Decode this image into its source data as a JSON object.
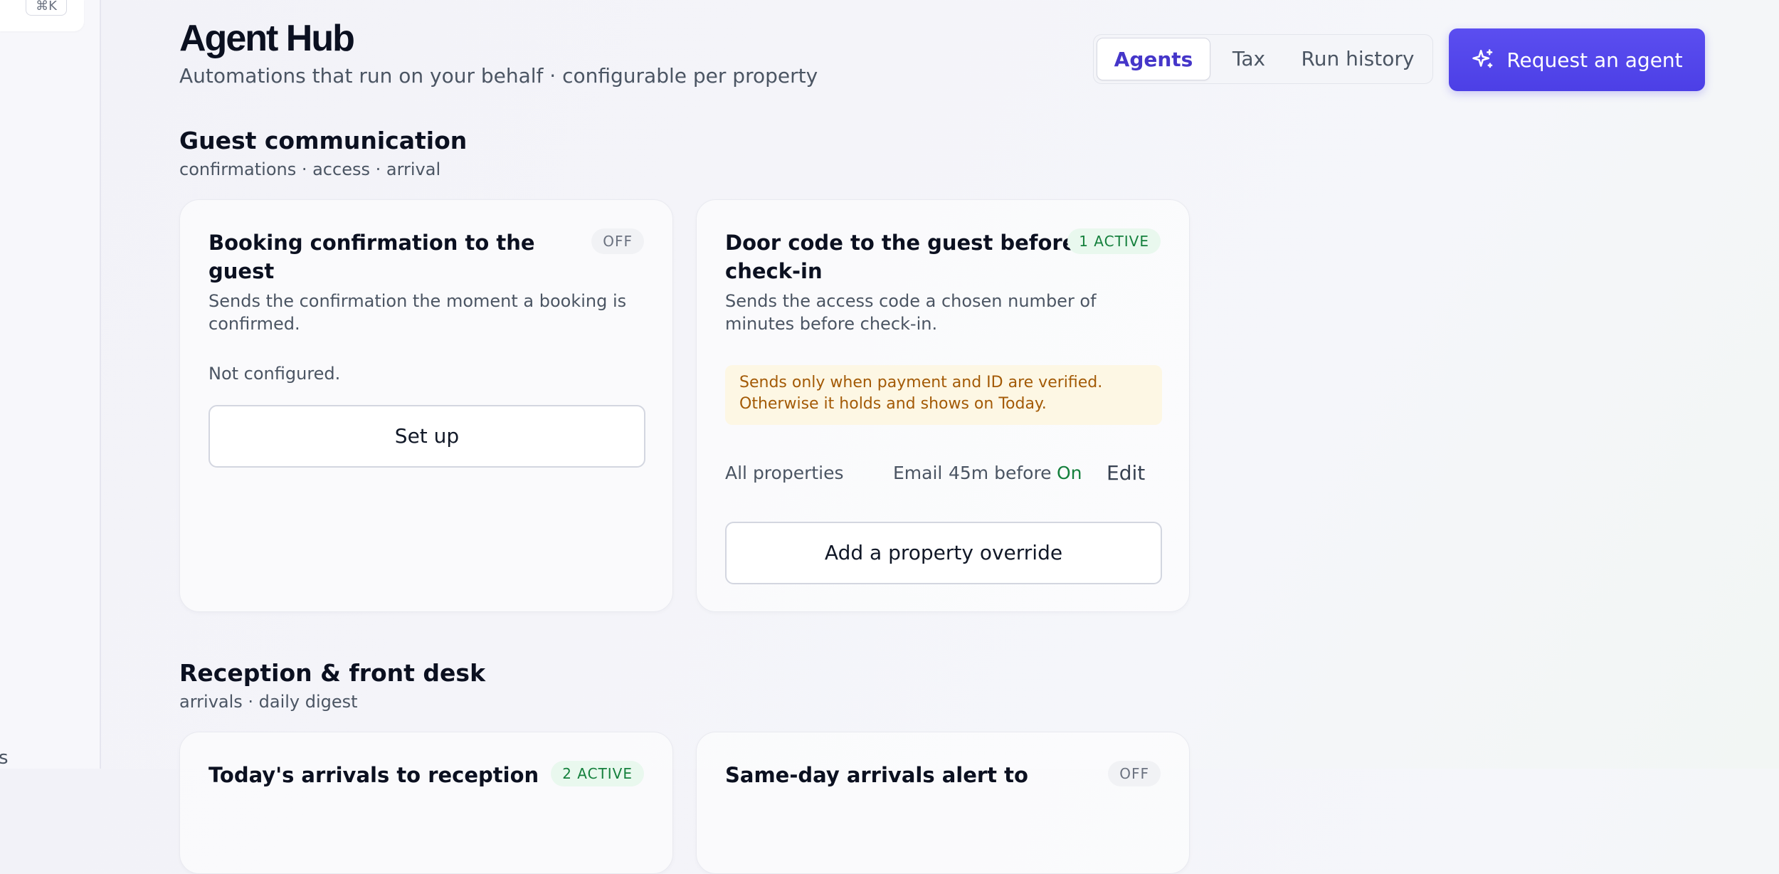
{
  "sidebar": {
    "shortcut": "⌘K",
    "fragment": "s"
  },
  "header": {
    "title": "Agent Hub",
    "subtitle": "Automations that run on your behalf · configurable per property",
    "tabs": [
      {
        "label": "Agents",
        "active": true
      },
      {
        "label": "Tax",
        "active": false
      },
      {
        "label": "Run history",
        "active": false
      }
    ],
    "request_button": {
      "label": "Request an agent",
      "icon": "sparkle-icon"
    }
  },
  "sections": [
    {
      "title": "Guest communication",
      "subtitle": "confirmations · access · arrival",
      "cards": [
        {
          "title": "Booking confirmation to the guest",
          "badge": "OFF",
          "description": "Sends the confirmation the moment a booking is confirmed.",
          "status_text": "Not configured.",
          "action": "Set up"
        },
        {
          "title": "Door code to the guest before check-in",
          "badge": "1 ACTIVE",
          "description": "Sends the access code a chosen number of minutes before check-in.",
          "notice": "Sends only when payment and ID are verified. Otherwise it holds and shows on Today.",
          "rule": {
            "scope": "All properties",
            "channel": "Email",
            "timing": "45m before",
            "status": "On",
            "edit": "Edit"
          },
          "action": "Add a property override"
        }
      ]
    },
    {
      "title": "Reception & front desk",
      "subtitle": "arrivals · daily digest",
      "cards": [
        {
          "title": "Today's arrivals to reception",
          "badge": "2 ACTIVE"
        },
        {
          "title": "Same-day arrivals alert to",
          "badge": "OFF"
        }
      ]
    }
  ],
  "colors": {
    "accent": "#4c3fe6",
    "active_text": "#15803d",
    "warning_text": "#a35a06",
    "warning_bg": "#fdf7e4"
  }
}
